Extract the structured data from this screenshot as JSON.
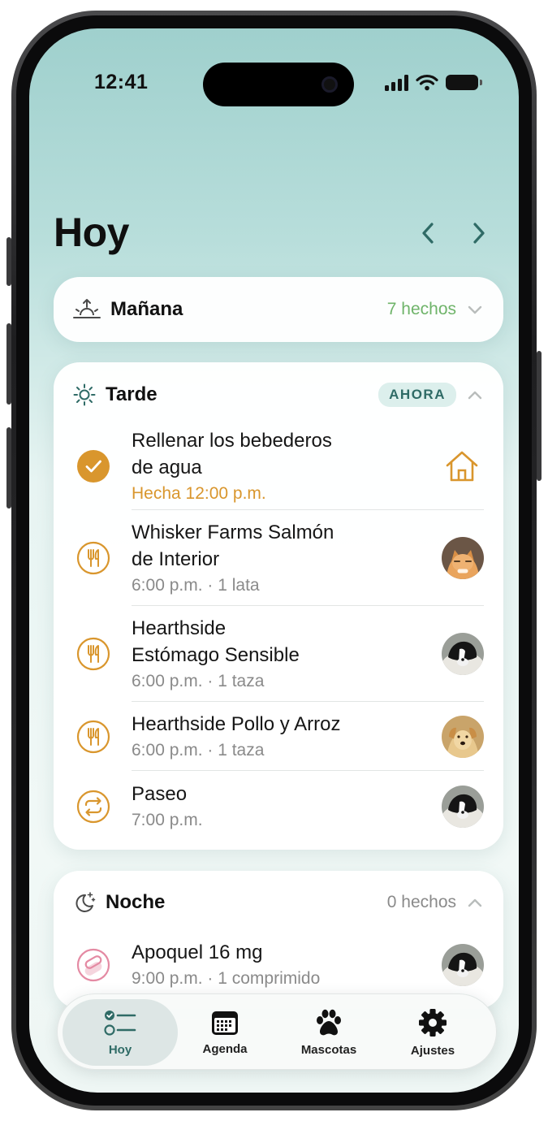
{
  "status_bar": {
    "time": "12:41"
  },
  "header": {
    "title": "Hoy"
  },
  "colors": {
    "accent": "#2f6b66",
    "orange": "#d9962d",
    "green_count": "#6fb46a",
    "pink": "#e48aa3"
  },
  "sections": {
    "morning": {
      "title": "Mañana",
      "count": "7 hechos",
      "icon": "sunrise-icon"
    },
    "afternoon": {
      "title": "Tarde",
      "badge": "AHORA",
      "icon": "sun-icon",
      "items": [
        {
          "line1": "Rellenar los bebederos",
          "line2": "de agua",
          "detail": "Hecha 12:00 p.m.",
          "icon": "check-circle-icon",
          "trailing": "house-icon"
        },
        {
          "line1": "Whisker Farms Salmón",
          "line2": "de Interior",
          "detail": "6:00 p.m. · 1 lata",
          "icon": "fork-knife-icon",
          "trailing": "cat-avatar"
        },
        {
          "line1": "Hearthside",
          "line2": "Estómago Sensible",
          "detail": "6:00 p.m. · 1 taza",
          "icon": "fork-knife-icon",
          "trailing": "dog-avatar"
        },
        {
          "line1": "Hearthside Pollo y Arroz",
          "line2": "",
          "detail": "6:00 p.m. · 1 taza",
          "icon": "fork-knife-icon",
          "trailing": "golden-dog-avatar"
        },
        {
          "line1": "Paseo",
          "line2": "",
          "detail": "7:00 p.m.",
          "icon": "repeat-icon",
          "trailing": "dog-avatar"
        }
      ]
    },
    "night": {
      "title": "Noche",
      "count": "0 hechos",
      "icon": "moon-stars-icon",
      "items": [
        {
          "line1": "Apoquel 16 mg",
          "detail": "9:00 p.m. · 1 comprimido",
          "icon": "pill-icon",
          "trailing": "dog-avatar"
        }
      ]
    }
  },
  "tabbar": {
    "tabs": [
      {
        "label": "Hoy",
        "icon": "checklist-icon",
        "active": true
      },
      {
        "label": "Agenda",
        "icon": "calendar-icon"
      },
      {
        "label": "Mascotas",
        "icon": "paw-icon"
      },
      {
        "label": "Ajustes",
        "icon": "gear-icon"
      }
    ]
  }
}
